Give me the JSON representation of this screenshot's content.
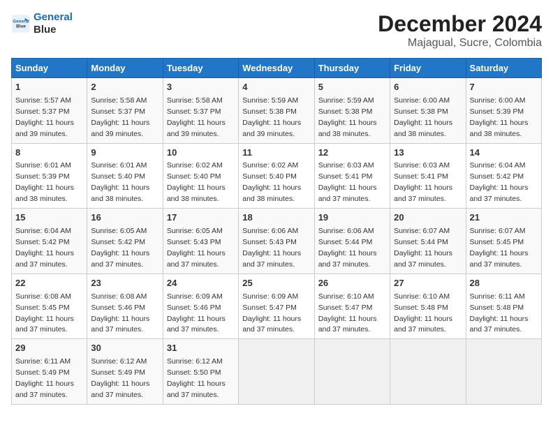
{
  "logo": {
    "line1": "General",
    "line2": "Blue"
  },
  "title": "December 2024",
  "subtitle": "Majagual, Sucre, Colombia",
  "days_of_week": [
    "Sunday",
    "Monday",
    "Tuesday",
    "Wednesday",
    "Thursday",
    "Friday",
    "Saturday"
  ],
  "weeks": [
    [
      {
        "day": "1",
        "sunrise": "5:57 AM",
        "sunset": "5:37 PM",
        "daylight": "11 hours and 39 minutes."
      },
      {
        "day": "2",
        "sunrise": "5:58 AM",
        "sunset": "5:37 PM",
        "daylight": "11 hours and 39 minutes."
      },
      {
        "day": "3",
        "sunrise": "5:58 AM",
        "sunset": "5:37 PM",
        "daylight": "11 hours and 39 minutes."
      },
      {
        "day": "4",
        "sunrise": "5:59 AM",
        "sunset": "5:38 PM",
        "daylight": "11 hours and 39 minutes."
      },
      {
        "day": "5",
        "sunrise": "5:59 AM",
        "sunset": "5:38 PM",
        "daylight": "11 hours and 38 minutes."
      },
      {
        "day": "6",
        "sunrise": "6:00 AM",
        "sunset": "5:38 PM",
        "daylight": "11 hours and 38 minutes."
      },
      {
        "day": "7",
        "sunrise": "6:00 AM",
        "sunset": "5:39 PM",
        "daylight": "11 hours and 38 minutes."
      }
    ],
    [
      {
        "day": "8",
        "sunrise": "6:01 AM",
        "sunset": "5:39 PM",
        "daylight": "11 hours and 38 minutes."
      },
      {
        "day": "9",
        "sunrise": "6:01 AM",
        "sunset": "5:40 PM",
        "daylight": "11 hours and 38 minutes."
      },
      {
        "day": "10",
        "sunrise": "6:02 AM",
        "sunset": "5:40 PM",
        "daylight": "11 hours and 38 minutes."
      },
      {
        "day": "11",
        "sunrise": "6:02 AM",
        "sunset": "5:40 PM",
        "daylight": "11 hours and 38 minutes."
      },
      {
        "day": "12",
        "sunrise": "6:03 AM",
        "sunset": "5:41 PM",
        "daylight": "11 hours and 37 minutes."
      },
      {
        "day": "13",
        "sunrise": "6:03 AM",
        "sunset": "5:41 PM",
        "daylight": "11 hours and 37 minutes."
      },
      {
        "day": "14",
        "sunrise": "6:04 AM",
        "sunset": "5:42 PM",
        "daylight": "11 hours and 37 minutes."
      }
    ],
    [
      {
        "day": "15",
        "sunrise": "6:04 AM",
        "sunset": "5:42 PM",
        "daylight": "11 hours and 37 minutes."
      },
      {
        "day": "16",
        "sunrise": "6:05 AM",
        "sunset": "5:42 PM",
        "daylight": "11 hours and 37 minutes."
      },
      {
        "day": "17",
        "sunrise": "6:05 AM",
        "sunset": "5:43 PM",
        "daylight": "11 hours and 37 minutes."
      },
      {
        "day": "18",
        "sunrise": "6:06 AM",
        "sunset": "5:43 PM",
        "daylight": "11 hours and 37 minutes."
      },
      {
        "day": "19",
        "sunrise": "6:06 AM",
        "sunset": "5:44 PM",
        "daylight": "11 hours and 37 minutes."
      },
      {
        "day": "20",
        "sunrise": "6:07 AM",
        "sunset": "5:44 PM",
        "daylight": "11 hours and 37 minutes."
      },
      {
        "day": "21",
        "sunrise": "6:07 AM",
        "sunset": "5:45 PM",
        "daylight": "11 hours and 37 minutes."
      }
    ],
    [
      {
        "day": "22",
        "sunrise": "6:08 AM",
        "sunset": "5:45 PM",
        "daylight": "11 hours and 37 minutes."
      },
      {
        "day": "23",
        "sunrise": "6:08 AM",
        "sunset": "5:46 PM",
        "daylight": "11 hours and 37 minutes."
      },
      {
        "day": "24",
        "sunrise": "6:09 AM",
        "sunset": "5:46 PM",
        "daylight": "11 hours and 37 minutes."
      },
      {
        "day": "25",
        "sunrise": "6:09 AM",
        "sunset": "5:47 PM",
        "daylight": "11 hours and 37 minutes."
      },
      {
        "day": "26",
        "sunrise": "6:10 AM",
        "sunset": "5:47 PM",
        "daylight": "11 hours and 37 minutes."
      },
      {
        "day": "27",
        "sunrise": "6:10 AM",
        "sunset": "5:48 PM",
        "daylight": "11 hours and 37 minutes."
      },
      {
        "day": "28",
        "sunrise": "6:11 AM",
        "sunset": "5:48 PM",
        "daylight": "11 hours and 37 minutes."
      }
    ],
    [
      {
        "day": "29",
        "sunrise": "6:11 AM",
        "sunset": "5:49 PM",
        "daylight": "11 hours and 37 minutes."
      },
      {
        "day": "30",
        "sunrise": "6:12 AM",
        "sunset": "5:49 PM",
        "daylight": "11 hours and 37 minutes."
      },
      {
        "day": "31",
        "sunrise": "6:12 AM",
        "sunset": "5:50 PM",
        "daylight": "11 hours and 37 minutes."
      },
      null,
      null,
      null,
      null
    ]
  ],
  "labels": {
    "sunrise": "Sunrise:",
    "sunset": "Sunset:",
    "daylight": "Daylight:"
  }
}
